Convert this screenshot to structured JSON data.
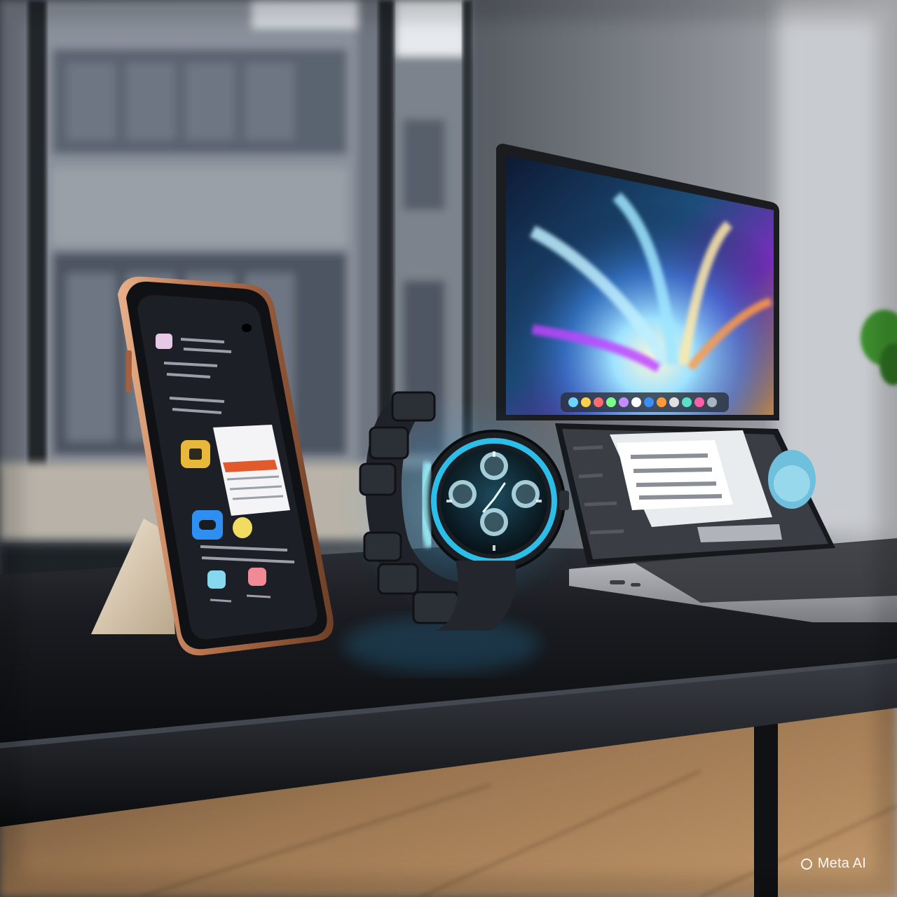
{
  "scene": {
    "description_objects": [
      "smartphone",
      "smartwatch",
      "laptop",
      "desk",
      "window",
      "plant"
    ]
  },
  "watermark": {
    "label": "Meta AI"
  },
  "colors": {
    "desk": "#15171b",
    "phone_frame": "#c98a66",
    "watch_glow": "#35c8ff",
    "laptop_screen_accent": "#b23cff"
  }
}
